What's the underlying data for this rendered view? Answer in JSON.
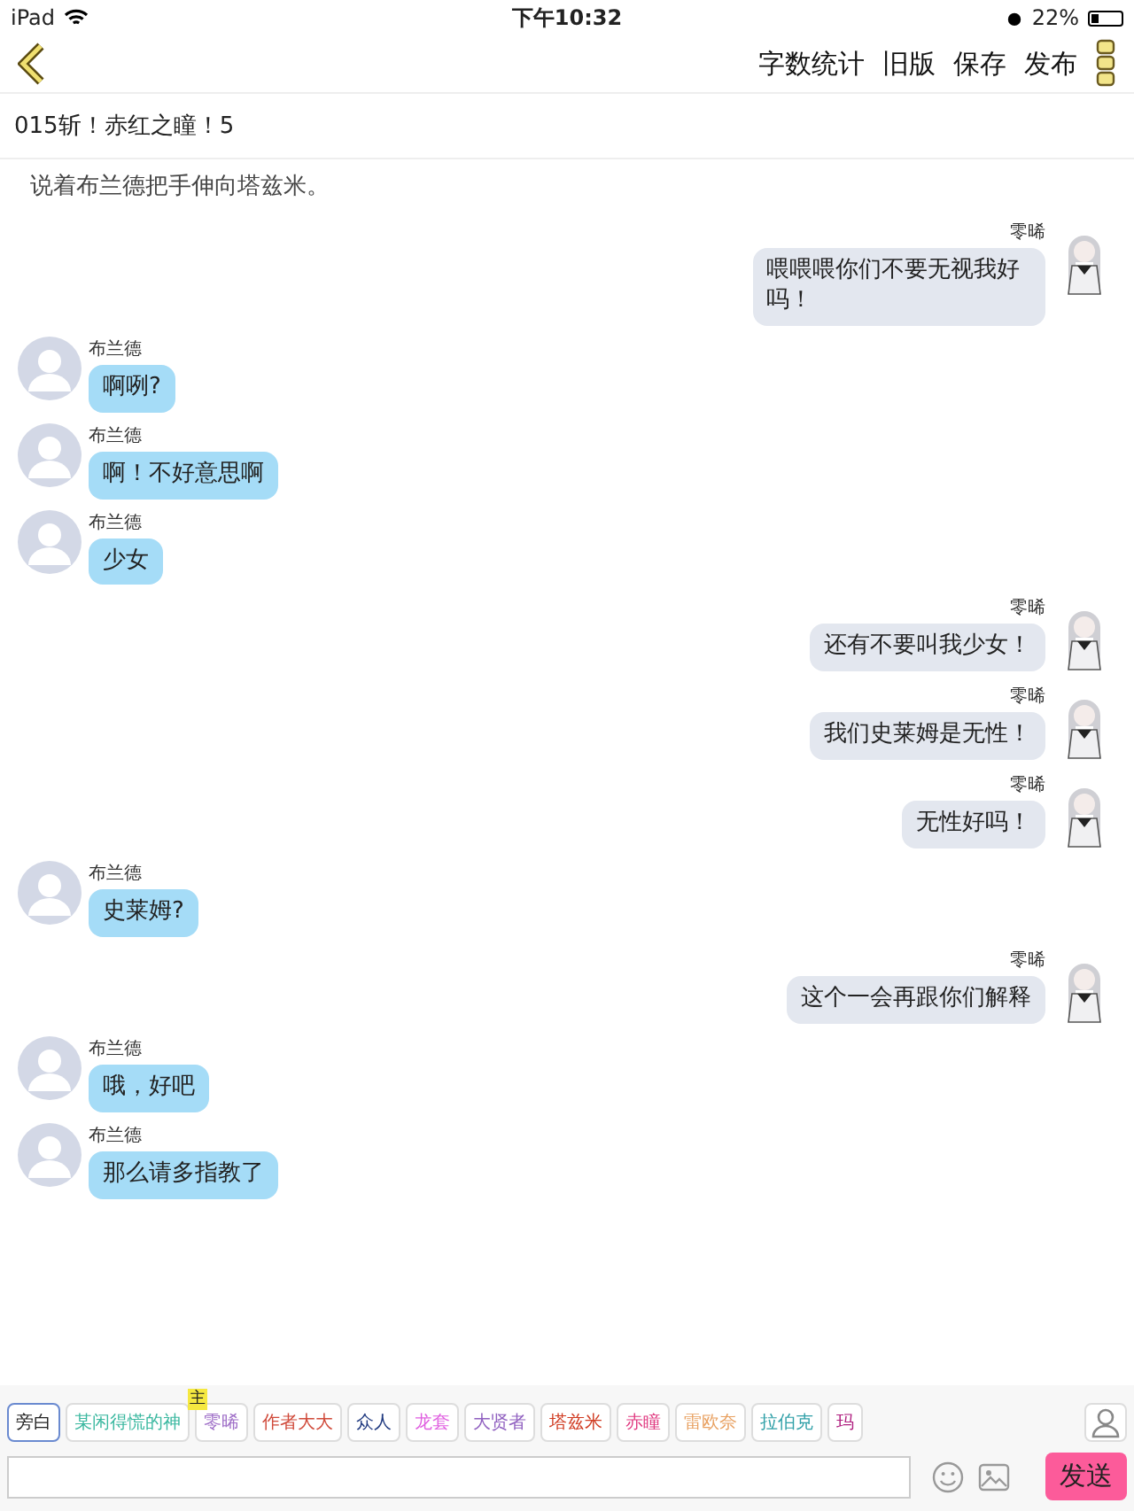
{
  "status_bar": {
    "device": "iPad",
    "time": "下午10:32",
    "battery_text": "22%"
  },
  "nav": {
    "actions": [
      "字数统计",
      "旧版",
      "保存",
      "发布"
    ]
  },
  "chapter_title": "015斩！赤红之瞳！5",
  "messages": [
    {
      "kind": "narration",
      "text": "说着布兰德把手伸向塔兹米。"
    },
    {
      "kind": "right",
      "name": "零晞",
      "text": "喂喂喂你们不要无视我好吗！"
    },
    {
      "kind": "left",
      "name": "布兰德",
      "text": "啊咧?"
    },
    {
      "kind": "left",
      "name": "布兰德",
      "text": "啊！不好意思啊"
    },
    {
      "kind": "left",
      "name": "布兰德",
      "text": "少女"
    },
    {
      "kind": "right",
      "name": "零晞",
      "text": "还有不要叫我少女！"
    },
    {
      "kind": "right",
      "name": "零晞",
      "text": "我们史莱姆是无性！"
    },
    {
      "kind": "right",
      "name": "零晞",
      "text": "无性好吗！"
    },
    {
      "kind": "left",
      "name": "布兰德",
      "text": "史莱姆?"
    },
    {
      "kind": "right",
      "name": "零晞",
      "text": "这个一会再跟你们解释"
    },
    {
      "kind": "left",
      "name": "布兰德",
      "text": "哦，好吧"
    },
    {
      "kind": "left",
      "name": "布兰德",
      "text": "那么请多指教了"
    }
  ],
  "characters": [
    {
      "label": "旁白",
      "color": "#222222",
      "selected": true
    },
    {
      "label": "某闲得慌的神",
      "color": "#3bb8a0",
      "selected": false
    },
    {
      "label": "零晞",
      "color": "#a070c8",
      "selected": false,
      "badge": "主"
    },
    {
      "label": "作者大大",
      "color": "#d04a3a",
      "selected": false
    },
    {
      "label": "众人",
      "color": "#203a80",
      "selected": false
    },
    {
      "label": "龙套",
      "color": "#e060e0",
      "selected": false
    },
    {
      "label": "大贤者",
      "color": "#9060c0",
      "selected": false
    },
    {
      "label": "塔兹米",
      "color": "#d03a20",
      "selected": false
    },
    {
      "label": "赤瞳",
      "color": "#e03a80",
      "selected": false
    },
    {
      "label": "雷欧奈",
      "color": "#e8a060",
      "selected": false
    },
    {
      "label": "拉伯克",
      "color": "#30a0a8",
      "selected": false
    },
    {
      "label": "玛",
      "color": "#b02080",
      "selected": false
    }
  ],
  "send_button": "发送"
}
